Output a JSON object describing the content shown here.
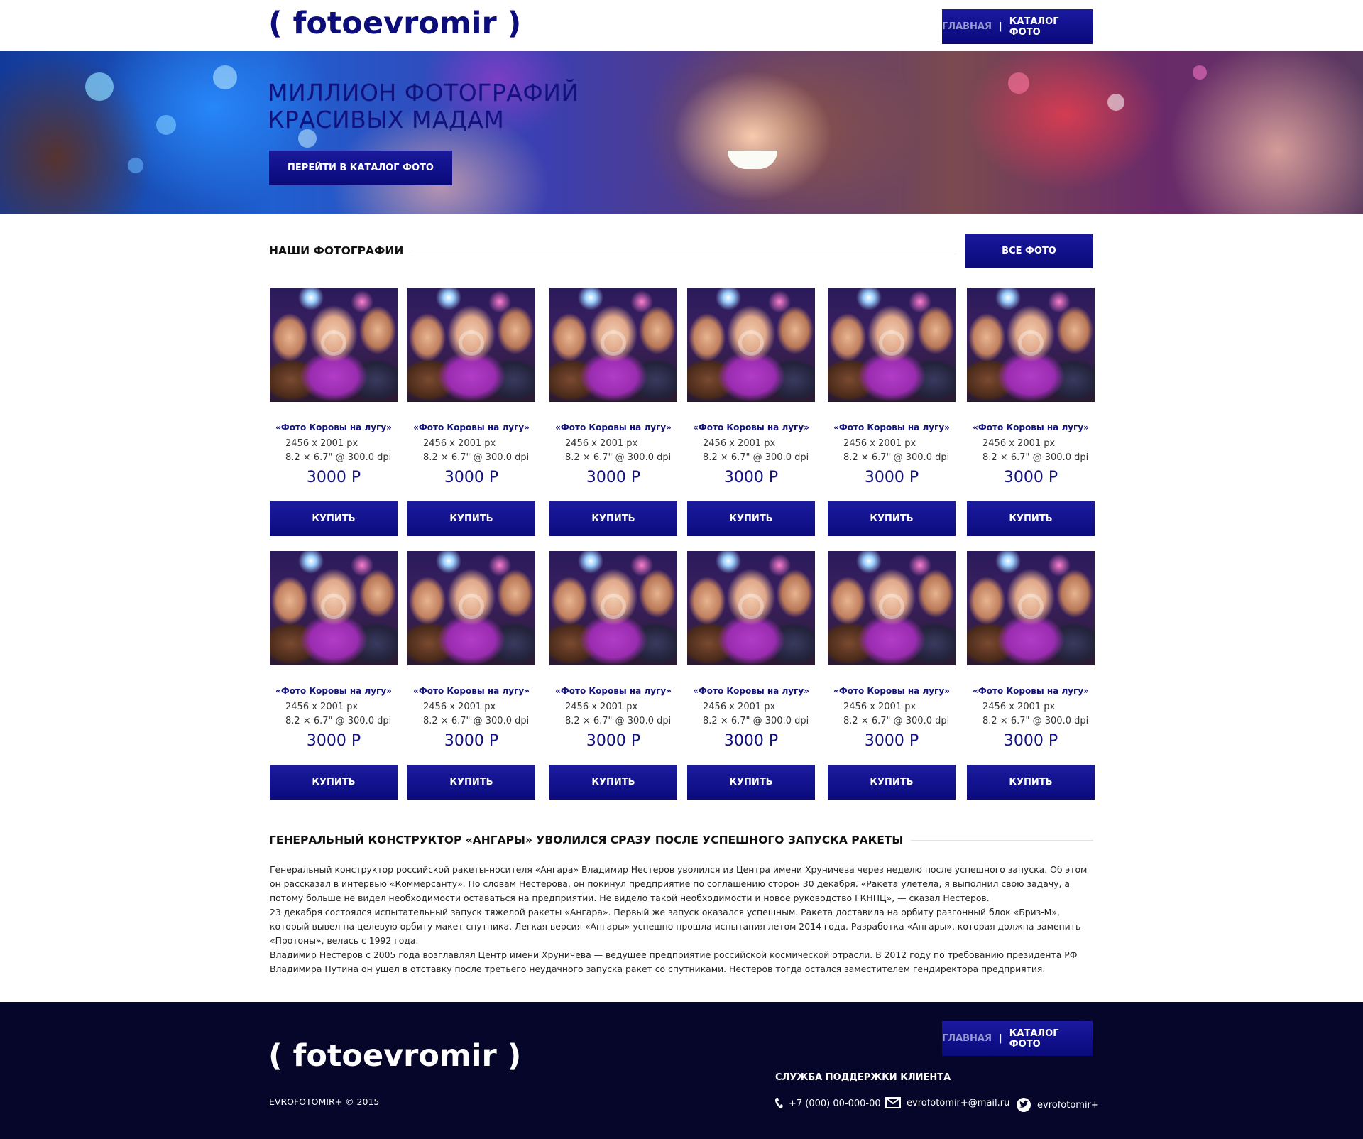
{
  "header": {
    "logo": "( fotoevromir )",
    "nav": {
      "home": "ГЛАВНАЯ",
      "separator": "|",
      "catalog": "КАТАЛОГ ФОТО"
    }
  },
  "hero": {
    "title_line1": "МИЛЛИОН ФОТОГРАФИЙ",
    "title_line2": "КРАСИВЫХ МАДАМ",
    "button": "ПЕРЕЙТИ В КАТАЛОГ ФОТО"
  },
  "photos_section": {
    "title": "НАШИ ФОТОГРАФИИ",
    "all_button": "ВСЕ ФОТО",
    "items": [
      {
        "name": "«Фото Коровы на лугу»",
        "size_px": "2456 x 2001 px",
        "size_in": "8.2 × 6.7\" @ 300.0 dpi",
        "price": "3000 Р",
        "buy": "КУПИТЬ"
      },
      {
        "name": "«Фото Коровы на лугу»",
        "size_px": "2456 x 2001 px",
        "size_in": "8.2 × 6.7\" @ 300.0 dpi",
        "price": "3000 Р",
        "buy": "КУПИТЬ"
      },
      {
        "name": "«Фото Коровы на лугу»",
        "size_px": "2456 x 2001 px",
        "size_in": "8.2 × 6.7\" @ 300.0 dpi",
        "price": "3000 Р",
        "buy": "КУПИТЬ"
      },
      {
        "name": "«Фото Коровы на лугу»",
        "size_px": "2456 x 2001 px",
        "size_in": "8.2 × 6.7\" @ 300.0 dpi",
        "price": "3000 Р",
        "buy": "КУПИТЬ"
      },
      {
        "name": "«Фото Коровы на лугу»",
        "size_px": "2456 x 2001 px",
        "size_in": "8.2 × 6.7\" @ 300.0 dpi",
        "price": "3000 Р",
        "buy": "КУПИТЬ"
      },
      {
        "name": "«Фото Коровы на лугу»",
        "size_px": "2456 x 2001 px",
        "size_in": "8.2 × 6.7\" @ 300.0 dpi",
        "price": "3000 Р",
        "buy": "КУПИТЬ"
      },
      {
        "name": "«Фото Коровы на лугу»",
        "size_px": "2456 x 2001 px",
        "size_in": "8.2 × 6.7\" @ 300.0 dpi",
        "price": "3000 Р",
        "buy": "КУПИТЬ"
      },
      {
        "name": "«Фото Коровы на лугу»",
        "size_px": "2456 x 2001 px",
        "size_in": "8.2 × 6.7\" @ 300.0 dpi",
        "price": "3000 Р",
        "buy": "КУПИТЬ"
      },
      {
        "name": "«Фото Коровы на лугу»",
        "size_px": "2456 x 2001 px",
        "size_in": "8.2 × 6.7\" @ 300.0 dpi",
        "price": "3000 Р",
        "buy": "КУПИТЬ"
      },
      {
        "name": "«Фото Коровы на лугу»",
        "size_px": "2456 x 2001 px",
        "size_in": "8.2 × 6.7\" @ 300.0 dpi",
        "price": "3000 Р",
        "buy": "КУПИТЬ"
      },
      {
        "name": "«Фото Коровы на лугу»",
        "size_px": "2456 x 2001 px",
        "size_in": "8.2 × 6.7\" @ 300.0 dpi",
        "price": "3000 Р",
        "buy": "КУПИТЬ"
      },
      {
        "name": "«Фото Коровы на лугу»",
        "size_px": "2456 x 2001 px",
        "size_in": "8.2 × 6.7\" @ 300.0 dpi",
        "price": "3000 Р",
        "buy": "КУПИТЬ"
      }
    ]
  },
  "article": {
    "title": "ГЕНЕРАЛЬНЫЙ КОНСТРУКТОР «АНГАРЫ» УВОЛИЛСЯ СРАЗУ ПОСЛЕ УСПЕШНОГО ЗАПУСКА РАКЕТЫ",
    "paragraph1": "Генеральный конструктор российской ракеты-носителя «Ангара» Владимир Нестеров уволился из Центра имени Хруничева через неделю после успешного запуска. Об этом он рассказал в интервью «Коммерсанту». По словам Нестерова, он покинул предприятие по соглашению сторон 30 декабря. «Ракета улетела, я выполнил свою задачу, а потому больше не видел необходимости оставаться на предприятии. Не видело такой необходимости и новое руководство ГКНПЦ», — сказал Нестеров.",
    "paragraph2": "23 декабря состоялся испытательный запуск тяжелой ракеты «Ангара». Первый же запуск оказался успешным. Ракета доставила на орбиту разгонный блок «Бриз-М», который вывел на целевую орбиту макет спутника. Легкая версия «Ангары» успешно прошла испытания летом 2014 года. Разработка «Ангары», которая должна заменить «Протоны», велась с 1992 года.",
    "paragraph3": "Владимир Нестеров с 2005 года возглавлял Центр имени Хруничева — ведущее предприятие российской космической отрасли. В 2012 году по требованию президента РФ Владимира Путина он ушел в отставку после третьего неудачного запуска ракет со спутниками. Нестеров тогда остался заместителем гендиректора предприятия."
  },
  "footer": {
    "logo": "( fotoevromir )",
    "copyright": "EVROFOTOMIR+ © 2015",
    "nav": {
      "home": "ГЛАВНАЯ",
      "separator": "|",
      "catalog": "КАТАЛОГ ФОТО"
    },
    "support_title": "СЛУЖБА ПОДДЕРЖКИ КЛИЕНТА",
    "phone": "+7 (000) 00-000-00",
    "email": "evrofotomir+@mail.ru",
    "twitter": "evrofotomir+"
  },
  "colors": {
    "brand": "#0c0c7a",
    "button": "#12128e",
    "footer_bg": "#06062a"
  },
  "icons": {
    "phone": "phone-icon",
    "email": "mail-icon",
    "twitter": "twitter-icon"
  }
}
